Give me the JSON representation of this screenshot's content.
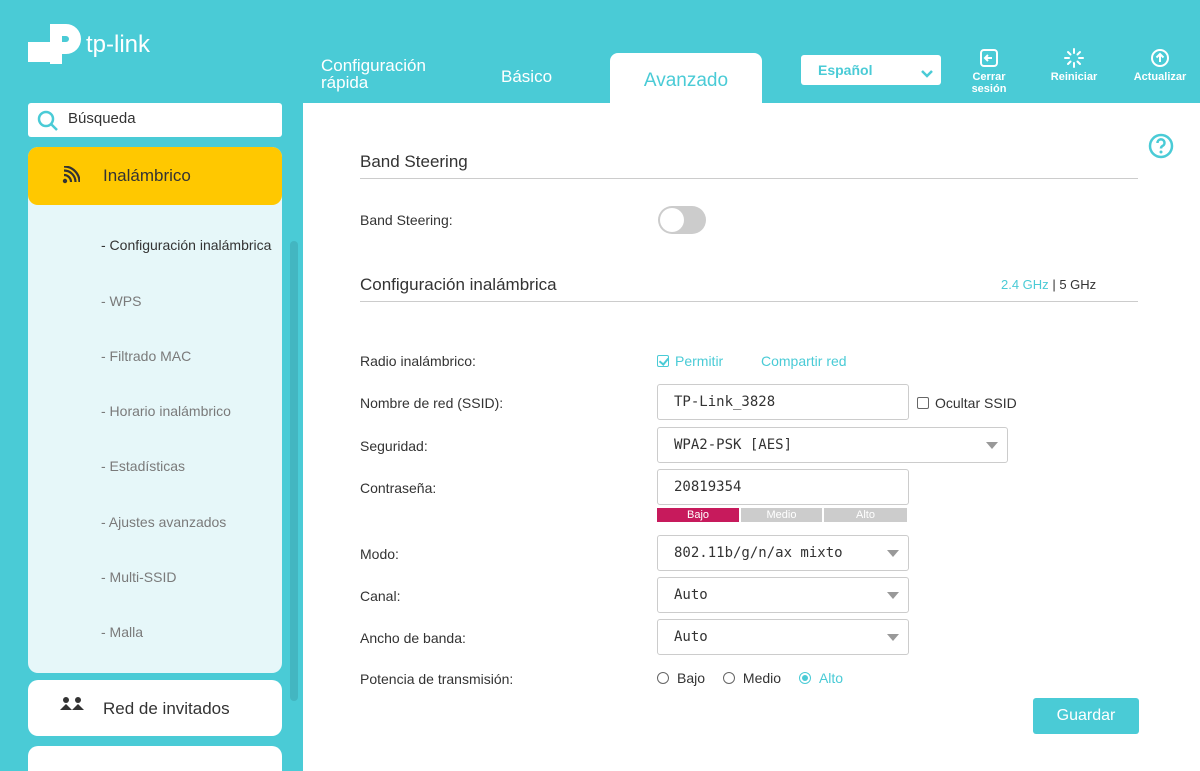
{
  "brand": {
    "name": "tp-link",
    "accent": "#4acbd6",
    "highlight": "#ffc800"
  },
  "header": {
    "tabs": [
      {
        "label": "Configuración rápida",
        "active": false
      },
      {
        "label": "Básico",
        "active": false
      },
      {
        "label": "Avanzado",
        "active": true
      }
    ],
    "language": "Español",
    "buttons": [
      {
        "label": "Cerrar sesión",
        "icon": "logout-icon"
      },
      {
        "label": "Reiniciar",
        "icon": "reboot-icon"
      },
      {
        "label": "Actualizar",
        "icon": "update-icon"
      }
    ]
  },
  "sidebar": {
    "search_placeholder": "Búsqueda",
    "active_section": {
      "label": "Inalámbrico",
      "icon": "wireless-icon"
    },
    "sub_items": [
      {
        "label": "- Configuración inalámbrica",
        "active": true
      },
      {
        "label": "- WPS"
      },
      {
        "label": "- Filtrado MAC"
      },
      {
        "label": "- Horario inalámbrico"
      },
      {
        "label": "- Estadísticas"
      },
      {
        "label": "- Ajustes avanzados"
      },
      {
        "label": "- Multi-SSID"
      },
      {
        "label": "- Malla"
      }
    ],
    "guest": {
      "label": "Red de invitados",
      "icon": "guest-network-icon"
    },
    "next_section_icon": "wifi-icon"
  },
  "main": {
    "band_steering": {
      "title": "Band Steering",
      "label": "Band Steering:",
      "enabled": false
    },
    "wireless": {
      "title": "Configuración inalámbrica",
      "band_24": "2.4 GHz",
      "band_5": "5 GHz",
      "separator": "|",
      "radio_label": "Radio inalámbrico:",
      "radio_enable": "Permitir",
      "radio_enabled": true,
      "share_link": "Compartir red",
      "ssid_label": "Nombre de red (SSID):",
      "ssid_value": "TP-Link_3828",
      "hide_ssid_label": "Ocultar SSID",
      "hide_ssid": false,
      "security_label": "Seguridad:",
      "security_value": "WPA2-PSK [AES]",
      "password_label": "Contraseña:",
      "password_value": "20819354",
      "strength": {
        "levels": [
          "Bajo",
          "Medio",
          "Alto"
        ],
        "current": "Bajo",
        "active_color": "#c71a5c",
        "inactive_color": "#cccccc"
      },
      "mode_label": "Modo:",
      "mode_value": "802.11b/g/n/ax mixto",
      "channel_label": "Canal:",
      "channel_value": "Auto",
      "width_label": "Ancho de banda:",
      "width_value": "Auto",
      "power_label": "Potencia de transmisión:",
      "power_options": [
        "Bajo",
        "Medio",
        "Alto"
      ],
      "power_selected": "Alto"
    },
    "save_label": "Guardar"
  }
}
